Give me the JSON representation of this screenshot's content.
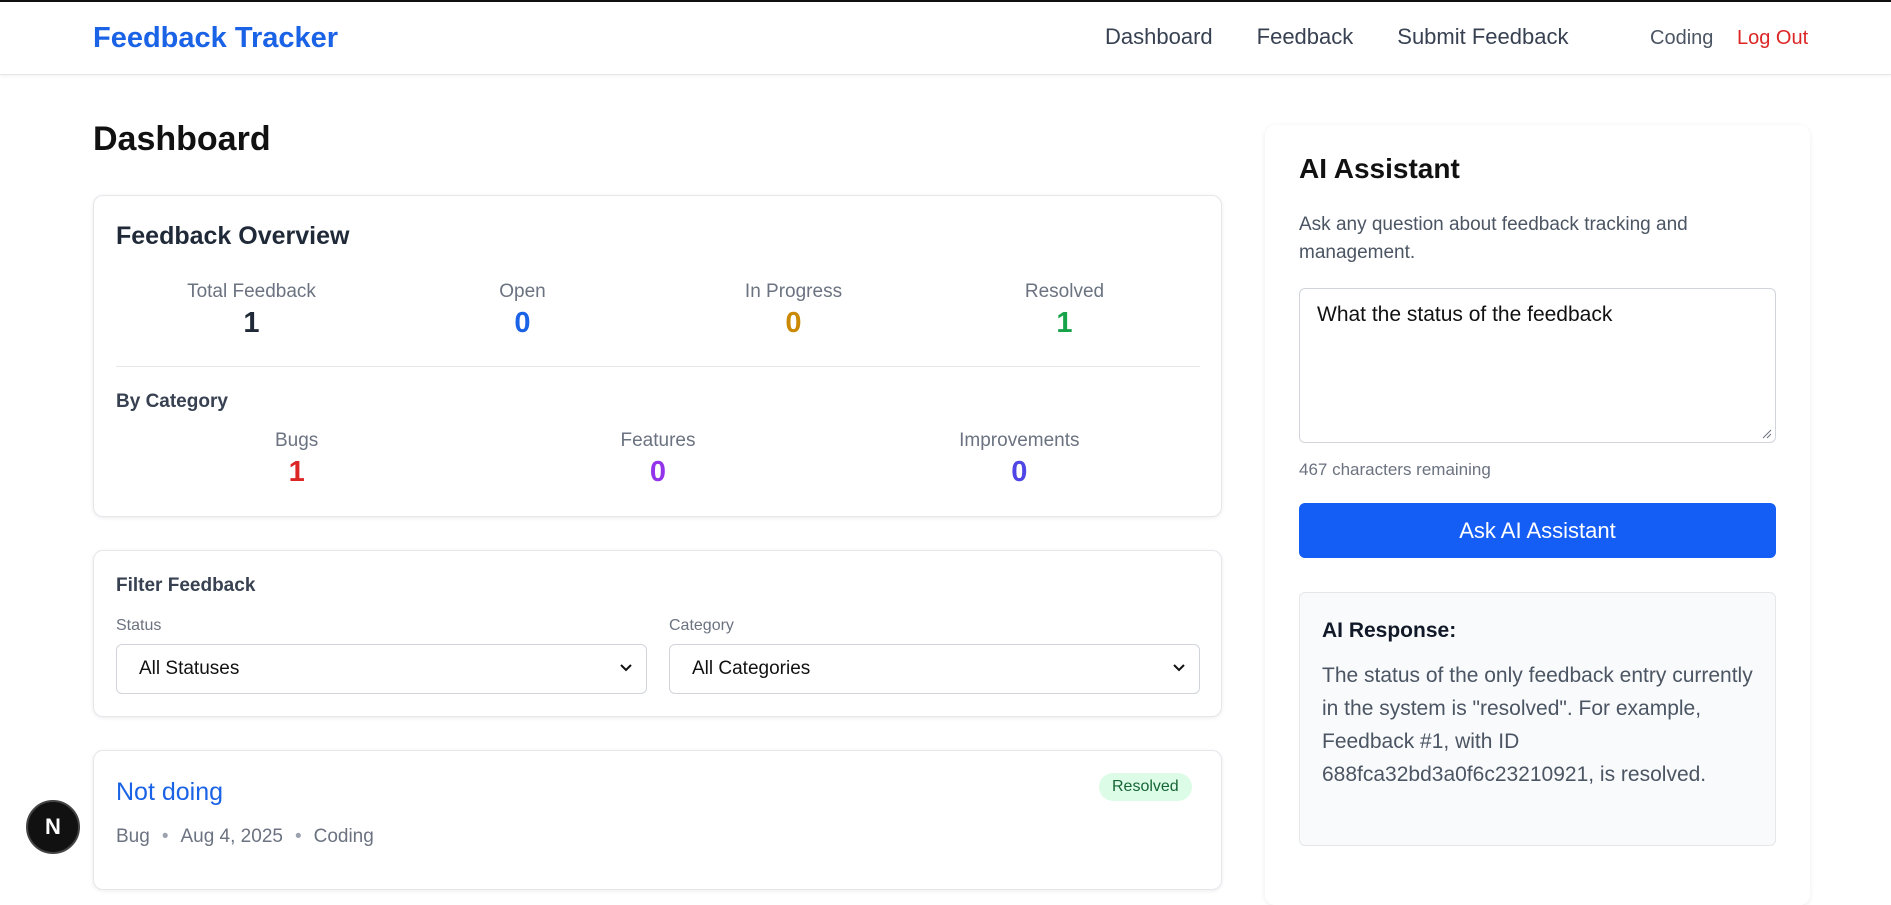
{
  "nav": {
    "brand": "Feedback Tracker",
    "links": [
      "Dashboard",
      "Feedback",
      "Submit Feedback"
    ],
    "user": "Coding",
    "logout": "Log Out"
  },
  "page": {
    "title": "Dashboard"
  },
  "overview": {
    "title": "Feedback Overview",
    "stats": [
      {
        "label": "Total Feedback",
        "value": "1",
        "color": "#1f2937"
      },
      {
        "label": "Open",
        "value": "0",
        "color": "#1a62e6"
      },
      {
        "label": "In Progress",
        "value": "0",
        "color": "#ca8a04"
      },
      {
        "label": "Resolved",
        "value": "1",
        "color": "#16a34a"
      }
    ],
    "category_title": "By Category",
    "categories": [
      {
        "label": "Bugs",
        "value": "1",
        "color": "#dc2626"
      },
      {
        "label": "Features",
        "value": "0",
        "color": "#9333ea"
      },
      {
        "label": "Improvements",
        "value": "0",
        "color": "#4f46e5"
      }
    ]
  },
  "filter": {
    "title": "Filter Feedback",
    "status_label": "Status",
    "status_value": "All Statuses",
    "category_label": "Category",
    "category_value": "All Categories"
  },
  "feedback_items": [
    {
      "title": "Not doing",
      "badge": "Resolved",
      "type": "Bug",
      "date": "Aug 4, 2025",
      "author": "Coding"
    }
  ],
  "ai": {
    "title": "AI Assistant",
    "description": "Ask any question about feedback tracking and management.",
    "question": "What the status of the feedback",
    "chars_remaining": "467 characters remaining",
    "button": "Ask AI Assistant",
    "response_title": "AI Response:",
    "response_text": "The status of the only feedback entry currently in the system is \"resolved\". For example, Feedback #1, with ID 688fca32bd3a0f6c23210921, is resolved."
  },
  "nextjs_badge": "N"
}
